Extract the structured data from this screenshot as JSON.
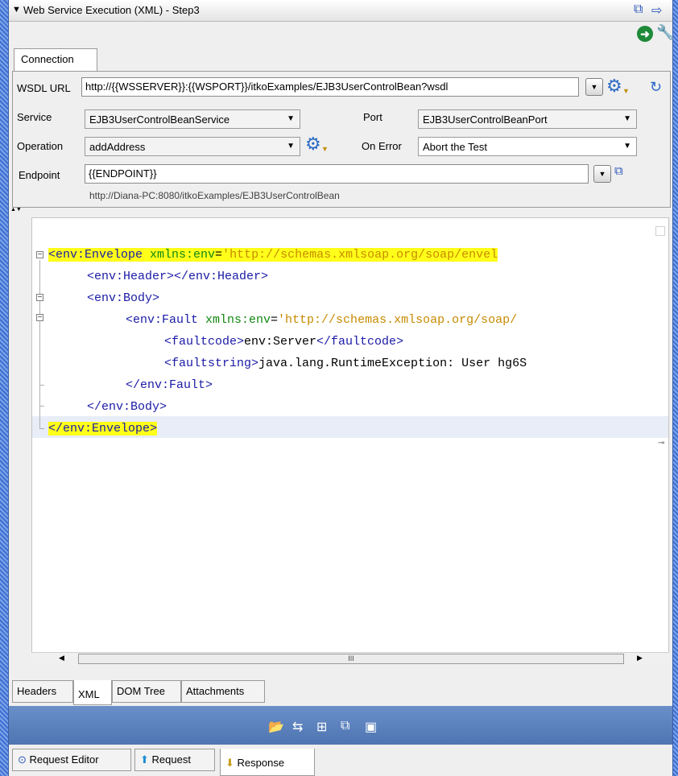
{
  "window": {
    "title": "Web Service Execution (XML) - Step3"
  },
  "tabs_top": [
    "Connection"
  ],
  "connection": {
    "wsdl_label": "WSDL URL",
    "wsdl_value": "http://{{WSSERVER}}:{{WSPORT}}/itkoExamples/EJB3UserControlBean?wsdl",
    "service_label": "Service",
    "service_value": "EJB3UserControlBeanService",
    "port_label": "Port",
    "port_value": "EJB3UserControlBeanPort",
    "operation_label": "Operation",
    "operation_value": "addAddress",
    "onerror_label": "On Error",
    "onerror_value": "Abort the Test",
    "endpoint_label": "Endpoint",
    "endpoint_value": "{{ENDPOINT}}",
    "endpoint_preview": "http://Diana-PC:8080/itkoExamples/EJB3UserControlBean"
  },
  "xml": {
    "l1_tag": "<env:Envelope",
    "l1_attr": " xmlns:env",
    "l1_eq": "=",
    "l1_val": "'http://schemas.xmlsoap.org/soap/envel",
    "l2": "<env:Header></env:Header>",
    "l3": "<env:Body>",
    "l4_tag": "<env:Fault",
    "l4_attr": " xmlns:env",
    "l4_eq": "=",
    "l4_val": "'http://schemas.xmlsoap.org/soap/",
    "l5_open": "<faultcode>",
    "l5_text": "env:Server",
    "l5_close": "</faultcode>",
    "l6_open": "<faultstring>",
    "l6_text": "java.lang.RuntimeException: User hg6S",
    "l7": "</env:Fault>",
    "l8": "</env:Body>",
    "l9": "</env:Envelope>"
  },
  "scroll_thumb_label": "III",
  "tabs_bottom": [
    "Headers",
    "XML",
    "DOM Tree",
    "Attachments"
  ],
  "tabs_footer": [
    "Request Editor",
    "Request",
    "Response"
  ]
}
